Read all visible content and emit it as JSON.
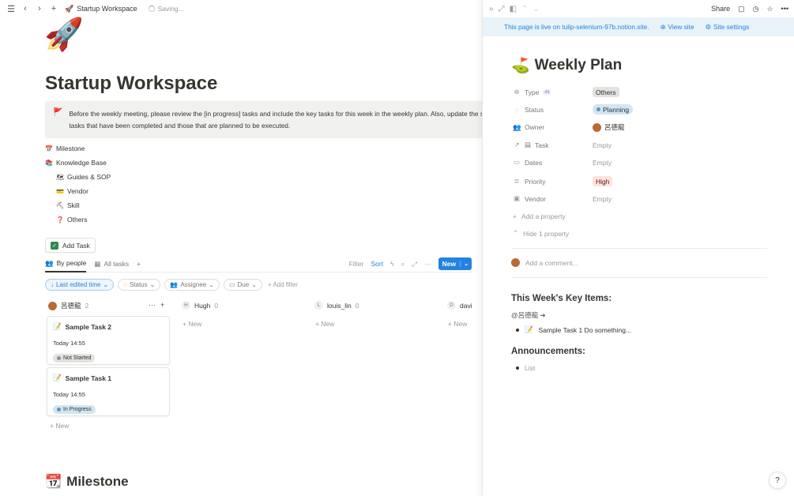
{
  "topbar": {
    "breadcrumb_icon": "🚀",
    "breadcrumb": "Startup Workspace",
    "status": "Saving..."
  },
  "page": {
    "icon": "🚀",
    "title": "Startup Workspace",
    "callout_icon": "🚩",
    "callout_line1": "Before the weekly meeting, please review the [in progress] tasks and include the key tasks for this week in the weekly plan. Also, update the s",
    "callout_line2": "tasks that have been completed and those that are planned to be executed.",
    "links": [
      {
        "emoji": "📅",
        "label": "Milestone"
      },
      {
        "emoji": "📚",
        "label": "Knowledge Base"
      },
      {
        "emoji": "🗺",
        "label": "Guides & SOP"
      },
      {
        "emoji": "💳",
        "label": "Vendor"
      },
      {
        "emoji": "⛏",
        "label": "Skill"
      },
      {
        "emoji": "❓",
        "label": "Others"
      }
    ],
    "add_task": "Add Task",
    "milestone_heading_icon": "📆",
    "milestone_heading": "Milestone"
  },
  "views": {
    "tabs": [
      {
        "icon": "👥",
        "label": "By people"
      },
      {
        "icon": "▦",
        "label": "All tasks"
      }
    ],
    "filter": "Filter",
    "sort": "Sort",
    "new": "New"
  },
  "filters": {
    "last_edited": "Last edited time",
    "status": "Status",
    "assignee": "Assignee",
    "due": "Due",
    "add_filter": "Add filter"
  },
  "board": {
    "columns": [
      {
        "name": "呂德龍",
        "count": "2",
        "avatar": ""
      },
      {
        "name": "Hugh",
        "count": "0",
        "avatar": "H"
      },
      {
        "name": "louis_lin",
        "count": "0",
        "avatar": "L"
      },
      {
        "name": "davi",
        "count": "",
        "avatar": "D"
      }
    ],
    "new_label": "New",
    "cards": [
      {
        "icon": "📝",
        "title": "Sample Task 2",
        "date": "Today 14:55",
        "status": "Not Started"
      },
      {
        "icon": "📝",
        "title": "Sample Task 1",
        "date": "Today 14:55",
        "status": "In Progress"
      }
    ]
  },
  "panel": {
    "share": "Share",
    "banner": "This page is live on tulip-selenium-97b.notion.site.",
    "view_site": "View site",
    "site_settings": "Site settings",
    "title_icon": "⛳",
    "title": "Weekly Plan",
    "props": {
      "type_label": "Type",
      "ai": "AI",
      "type_value": "Others",
      "status_label": "Status",
      "status_value": "Planning",
      "owner_label": "Owner",
      "owner_value": "呂德龍",
      "task_label": "Task",
      "task_value": "Empty",
      "dates_label": "Dates",
      "dates_value": "Empty",
      "priority_label": "Priority",
      "priority_value": "High",
      "vendor_label": "Vendor",
      "vendor_value": "Empty"
    },
    "add_property": "Add a property",
    "hide_property": "Hide 1 property",
    "comment_placeholder": "Add a comment...",
    "key_items_heading": "This Week's Key Items:",
    "mention": "@呂德龍 ➔",
    "key_item": "Sample Task 1 Do something...",
    "announcements_heading": "Announcements:",
    "announcement_item": "List",
    "help": "?"
  }
}
